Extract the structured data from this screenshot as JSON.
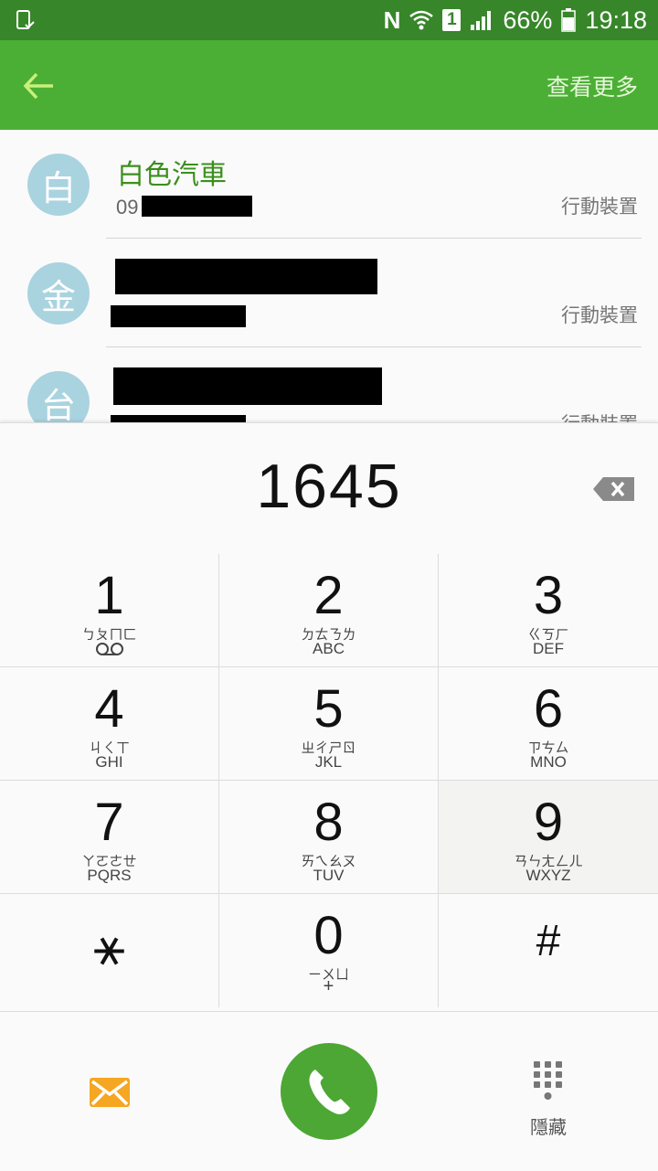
{
  "status_bar": {
    "battery": "66%",
    "time": "19:18",
    "sim": "1",
    "nfc": "N"
  },
  "app_bar": {
    "more_label": "查看更多"
  },
  "contacts": [
    {
      "avatar": "白",
      "name": "白色汽車",
      "number": "09",
      "type": "行動裝置"
    },
    {
      "avatar": "金",
      "name": "",
      "number": "",
      "type": "行動裝置"
    },
    {
      "avatar": "台",
      "name": "",
      "number": "",
      "type": "行動裝置"
    }
  ],
  "dialer": {
    "number": "1645"
  },
  "keypad": [
    {
      "digit": "1",
      "bopo": "ㄅㄆㄇㄈ",
      "letters": ""
    },
    {
      "digit": "2",
      "bopo": "ㄉㄊㄋㄌ",
      "letters": "ABC"
    },
    {
      "digit": "3",
      "bopo": "ㄍㄎㄏ",
      "letters": "DEF"
    },
    {
      "digit": "4",
      "bopo": "ㄐㄑㄒ",
      "letters": "GHI"
    },
    {
      "digit": "5",
      "bopo": "ㄓㄔㄕㄖ",
      "letters": "JKL"
    },
    {
      "digit": "6",
      "bopo": "ㄗㄘㄙ",
      "letters": "MNO"
    },
    {
      "digit": "7",
      "bopo": "ㄚㄛㄜㄝ",
      "letters": "PQRS"
    },
    {
      "digit": "8",
      "bopo": "ㄞㄟㄠㄡ",
      "letters": "TUV"
    },
    {
      "digit": "9",
      "bopo": "ㄢㄣㄤㄥㄦ",
      "letters": "WXYZ"
    },
    {
      "digit": "⚹",
      "bopo": "",
      "letters": ""
    },
    {
      "digit": "0",
      "bopo": "ㄧㄨㄩ",
      "letters": "+"
    },
    {
      "digit": "#",
      "bopo": "",
      "letters": ""
    }
  ],
  "bottom": {
    "hide_label": "隱藏"
  },
  "colors": {
    "status_bar": "#37862a",
    "app_bar": "#4caf35",
    "call": "#4ca735",
    "message": "#f5a623"
  }
}
